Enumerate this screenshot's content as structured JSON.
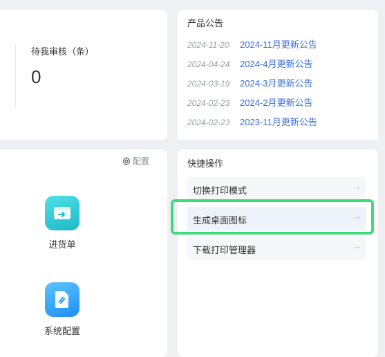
{
  "stats": {
    "pending_review_label": "待我审核（条）",
    "pending_review_value": "0"
  },
  "announcements": {
    "title": "产品公告",
    "items": [
      {
        "date": "2024-11-20",
        "text": "2024-11月更新公告"
      },
      {
        "date": "2024-04-24",
        "text": "2024-4月更新公告"
      },
      {
        "date": "2024-03-19",
        "text": "2024-3月更新公告"
      },
      {
        "date": "2024-02-23",
        "text": "2024-2月更新公告"
      },
      {
        "date": "2024-02-23",
        "text": "2023-11月更新公告"
      }
    ]
  },
  "apps": {
    "config_label": "配置",
    "items": [
      {
        "label": "进货单",
        "icon": "inbound-icon",
        "color": "#2cc8d2"
      },
      {
        "label": "系统配置",
        "icon": "settings-doc-icon",
        "color": "#2b9af3"
      }
    ]
  },
  "quick_actions": {
    "title": "快捷操作",
    "arrow_glyph": "→",
    "items": [
      {
        "label": "切换打印模式"
      },
      {
        "label": "生成桌面图标"
      },
      {
        "label": "下载打印管理器"
      }
    ]
  },
  "colors": {
    "link": "#3a6ed8",
    "highlight": "#3ddc7a",
    "background": "#eef0f4"
  }
}
